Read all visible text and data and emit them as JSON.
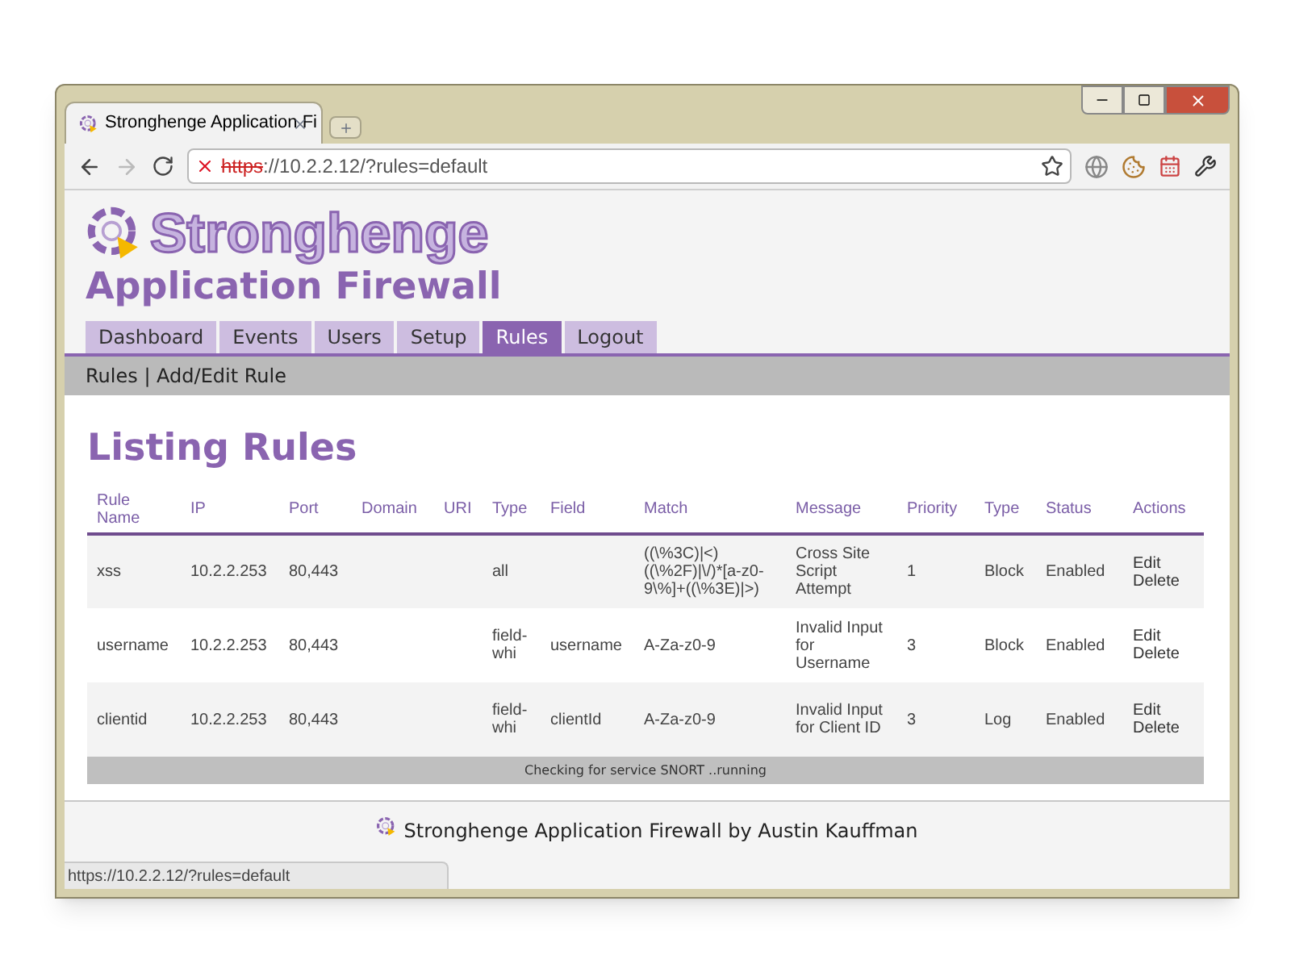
{
  "browser": {
    "tab_title": "Stronghenge Application Fi",
    "url_scheme": "https",
    "url_rest": "://10.2.2.12/?rules=default",
    "status_url": "https://10.2.2.12/?rules=default"
  },
  "site": {
    "logo_text": "Stronghenge",
    "subtitle": "Application Firewall"
  },
  "nav": [
    {
      "label": "Dashboard",
      "selected": false
    },
    {
      "label": "Events",
      "selected": false
    },
    {
      "label": "Users",
      "selected": false
    },
    {
      "label": "Setup",
      "selected": false
    },
    {
      "label": "Rules",
      "selected": true
    },
    {
      "label": "Logout",
      "selected": false
    }
  ],
  "breadcrumb": "Rules | Add/Edit Rule",
  "heading": "Listing Rules",
  "table": {
    "columns": [
      "Rule Name",
      "IP",
      "Port",
      "Domain",
      "URI",
      "Type",
      "Field",
      "Match",
      "Message",
      "Priority",
      "Type",
      "Status",
      "Actions"
    ],
    "rows": [
      {
        "cells": [
          "xss",
          "10.2.2.253",
          "80,443",
          "",
          "",
          "all",
          "",
          "((\\%3C)|<)((\\%2F)|\\/)*[a-z0-9\\%]+((\\%3E)|>)",
          "Cross Site Script Attempt",
          "1",
          "Block",
          "Enabled"
        ],
        "actions": [
          "Edit",
          "Delete"
        ]
      },
      {
        "cells": [
          "username",
          "10.2.2.253",
          "80,443",
          "",
          "",
          "field-whi",
          "username",
          "A-Za-z0-9",
          "Invalid Input for Username",
          "3",
          "Block",
          "Enabled"
        ],
        "actions": [
          "Edit",
          "Delete"
        ]
      },
      {
        "cells": [
          "clientid",
          "10.2.2.253",
          "80,443",
          "",
          "",
          "field-whi",
          "clientId",
          "A-Za-z0-9",
          "Invalid Input for Client ID",
          "3",
          "Log",
          "Enabled"
        ],
        "actions": [
          "Edit",
          "Delete"
        ]
      }
    ]
  },
  "service_status": "Checking for service SNORT ..running",
  "footer": "Stronghenge Application Firewall by Austin Kauffman"
}
